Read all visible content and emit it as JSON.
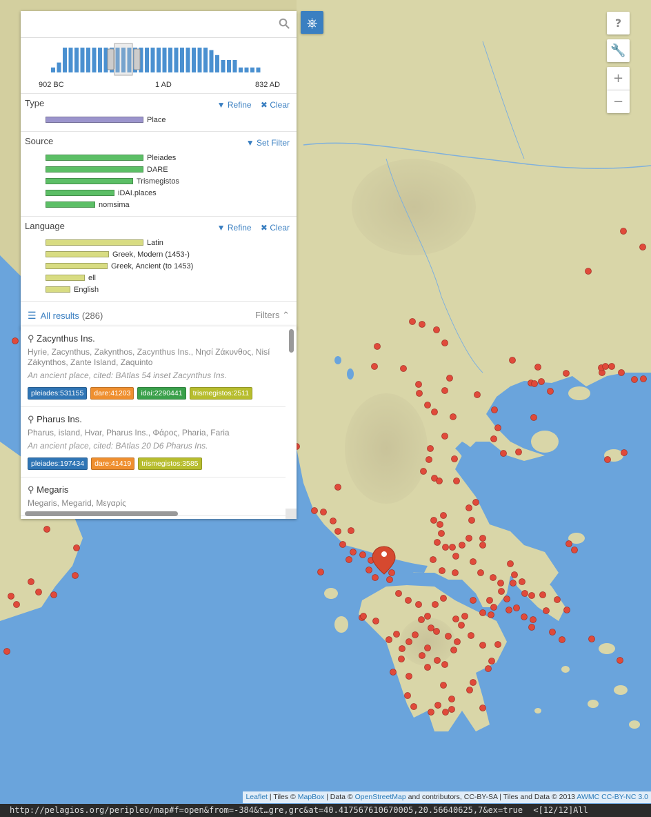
{
  "search": {
    "placeholder": "",
    "value": ""
  },
  "timeline": {
    "start_label": "902 BC",
    "mid_label": "1 AD",
    "end_label": "832 AD",
    "histogram": [
      2,
      4,
      10,
      10,
      10,
      10,
      10,
      10,
      10,
      10,
      10,
      10,
      10,
      10,
      10,
      10,
      10,
      10,
      10,
      10,
      10,
      10,
      10,
      10,
      10,
      10,
      10,
      9,
      7,
      5,
      5,
      5,
      2,
      2,
      2,
      2
    ]
  },
  "facets": {
    "type": {
      "title": "Type",
      "refine": "Refine",
      "clear": "Clear",
      "items": [
        {
          "label": "Place",
          "value": 1.0,
          "color": "#9b94cc"
        }
      ]
    },
    "source": {
      "title": "Source",
      "set_filter": "Set Filter",
      "items": [
        {
          "label": "Pleiades",
          "value": 1.0,
          "color": "#5cbf66"
        },
        {
          "label": "DARE",
          "value": 1.0,
          "color": "#5cbf66"
        },
        {
          "label": "Trismegistos",
          "value": 0.89,
          "color": "#5cbf66"
        },
        {
          "label": "iDAI.places",
          "value": 0.7,
          "color": "#5cbf66"
        },
        {
          "label": "nomsima",
          "value": 0.5,
          "color": "#5cbf66"
        }
      ]
    },
    "language": {
      "title": "Language",
      "refine": "Refine",
      "clear": "Clear",
      "items": [
        {
          "label": "Latin",
          "value": 1.0,
          "color": "#d8dc82"
        },
        {
          "label": "Greek, Modern (1453-)",
          "value": 0.64,
          "color": "#d8dc82"
        },
        {
          "label": "Greek, Ancient (to 1453)",
          "value": 0.63,
          "color": "#d8dc82"
        },
        {
          "label": "ell",
          "value": 0.39,
          "color": "#d8dc82"
        },
        {
          "label": "English",
          "value": 0.24,
          "color": "#d8dc82"
        }
      ]
    }
  },
  "results_header": {
    "all_results": "All results",
    "count": "(286)",
    "filters": "Filters"
  },
  "results": [
    {
      "title": "Zacynthus Ins.",
      "names": "Hyrie, Zacynthus, Zakynthos, Zacynthus Ins., Νησί Ζάκυνθος, Nisí Zákynthos, Zante Island, Zaquinto",
      "desc": "An ancient place, cited: BAtlas 54 inset Zacynthus Ins.",
      "tags": [
        {
          "label": "pleiades:531155",
          "color": "#2f75b5"
        },
        {
          "label": "dare:41203",
          "color": "#ef8f2f"
        },
        {
          "label": "idai:2290441",
          "color": "#3aa04a"
        },
        {
          "label": "trismegistos:2511",
          "color": "#b7bd2e"
        }
      ]
    },
    {
      "title": "Pharus Ins.",
      "names": "Pharus, island, Hvar, Pharus Ins., Φάρος, Pharia, Faria",
      "desc": "An ancient place, cited: BAtlas 20 D6 Pharus Ins.",
      "tags": [
        {
          "label": "pleiades:197434",
          "color": "#2f75b5"
        },
        {
          "label": "dare:41419",
          "color": "#ef8f2f"
        },
        {
          "label": "trismegistos:3585",
          "color": "#b7bd2e"
        }
      ]
    },
    {
      "title": "Megaris",
      "names": "Megaris, Megarid, Μεγαρίς",
      "desc": "",
      "tags": []
    }
  ],
  "map_controls": {
    "help": "?",
    "zoom_in": "+",
    "zoom_out": "−"
  },
  "attribution": {
    "leaflet": "Leaflet",
    "tiles_prefix": "| Tiles ©",
    "mapbox": "MapBox",
    "data_prefix": "| Data ©",
    "osm": "OpenStreetMap",
    "osm_suffix": "and contributors, CC-BY-SA | Tiles and Data © 2013",
    "awmc": "AWMC CC-BY-NC 3.0"
  },
  "statusbar": {
    "url": "http://pelagios.org/peripleo/map#f=open&from=-384&t…gre,grc&at=40.417567610670005,20.56640625,7&ex=true",
    "position": "<[12/12]All"
  },
  "colors": {
    "sea": "#6aa4dc",
    "land": "#d9d6a8",
    "marker": "#e04a3a",
    "accent": "#3a7fc1"
  }
}
